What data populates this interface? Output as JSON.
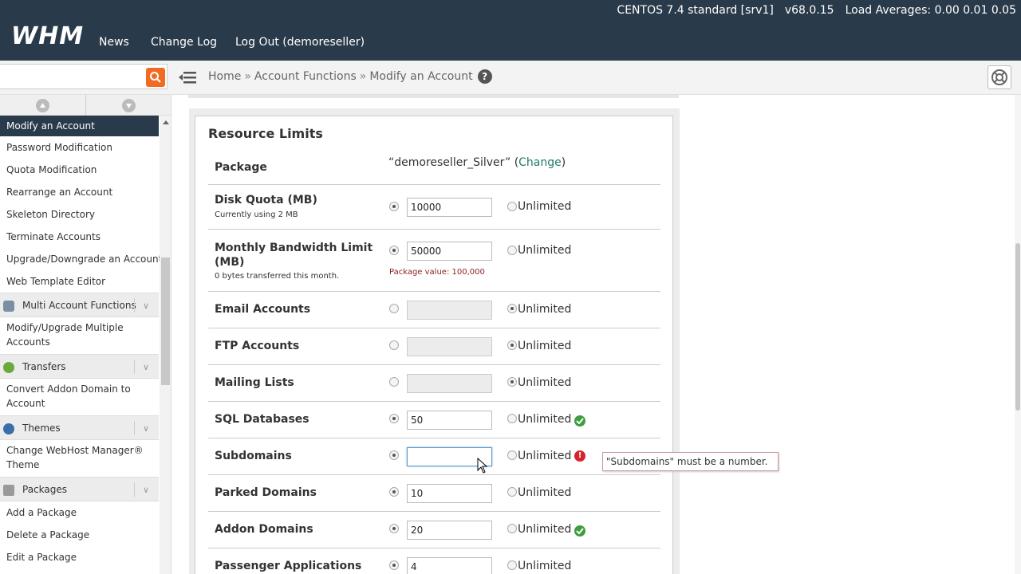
{
  "topbar": {
    "logo": "WHM",
    "nav": [
      "News",
      "Change Log",
      "Log Out (demoreseller)"
    ],
    "server_name": "CENTOS 7.4 standard [srv1]",
    "version": "v68.0.15",
    "load_averages": "Load Averages: 0.00 0.01 0.05"
  },
  "search": {
    "placeholder": "",
    "value": ""
  },
  "breadcrumb": {
    "home": "Home",
    "section": "Account Functions",
    "page": "Modify an Account",
    "sep": "»"
  },
  "sidebar": {
    "items": [
      {
        "label": "Modify an Account",
        "active": true
      },
      {
        "label": "Password Modification"
      },
      {
        "label": "Quota Modification"
      },
      {
        "label": "Rearrange an Account"
      },
      {
        "label": "Skeleton Directory"
      },
      {
        "label": "Terminate Accounts"
      },
      {
        "label": "Upgrade/Downgrade an Account"
      },
      {
        "label": "Web Template Editor"
      }
    ],
    "group_multi": "Multi Account Functions",
    "multi_items": [
      "Modify/Upgrade Multiple Accounts"
    ],
    "group_transfers": "Transfers",
    "transfer_items": [
      "Convert Addon Domain to Account"
    ],
    "group_themes": "Themes",
    "theme_items": [
      "Change WebHost Manager® Theme"
    ],
    "group_packages": "Packages",
    "package_items": [
      "Add a Package",
      "Delete a Package",
      "Edit a Package"
    ]
  },
  "panel": {
    "title": "Resource Limits",
    "package_label": "Package",
    "package_value": "“demoreseller_Silver”",
    "change_open": "(",
    "change_link": "Change",
    "change_close": ")",
    "unlimited": "Unlimited",
    "rows": [
      {
        "label": "Disk Quota (MB)",
        "sub": "Currently using 2 MB",
        "value": "10000",
        "mode": "value"
      },
      {
        "label": "Monthly Bandwidth Limit (MB)",
        "sub": "0 bytes transferred this month.",
        "value": "50000",
        "pkg": "Package value: 100,000",
        "mode": "value"
      },
      {
        "label": "Email Accounts",
        "value": "",
        "mode": "unlimited"
      },
      {
        "label": "FTP Accounts",
        "value": "",
        "mode": "unlimited"
      },
      {
        "label": "Mailing Lists",
        "value": "",
        "mode": "unlimited"
      },
      {
        "label": "SQL Databases",
        "value": "50",
        "mode": "value",
        "status": "ok"
      },
      {
        "label": "Subdomains",
        "value": "",
        "mode": "value",
        "status": "error"
      },
      {
        "label": "Parked Domains",
        "value": "10",
        "mode": "value"
      },
      {
        "label": "Addon Domains",
        "value": "20",
        "mode": "value",
        "status": "ok"
      },
      {
        "label": "Passenger Applications",
        "value": "4",
        "mode": "value"
      }
    ],
    "error_tooltip": "\"Subdomains\" must be a number."
  },
  "colors": {
    "topbar": "#293a4a",
    "accent": "#f26b22",
    "link": "#1f7a6d",
    "ok": "#3c9e3c",
    "error": "#d9232d"
  }
}
